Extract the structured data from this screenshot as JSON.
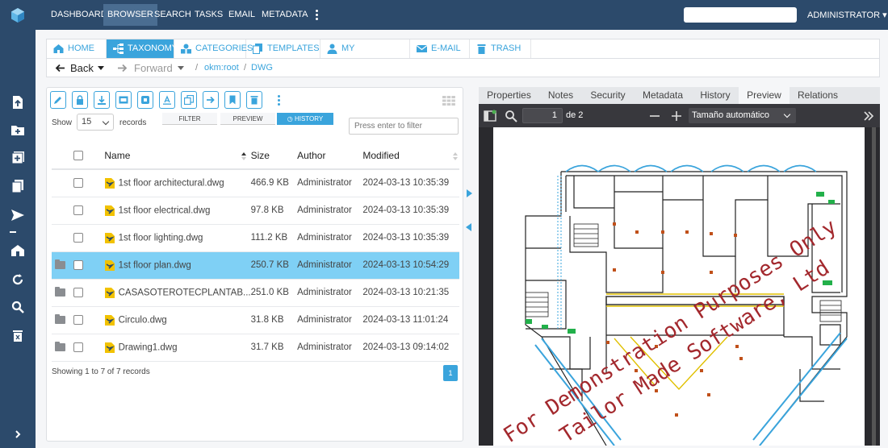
{
  "topnav": {
    "items": [
      "DASHBOARD",
      "BROWSER",
      "SEARCH",
      "TASKS",
      "EMAIL",
      "METADATA"
    ],
    "active": "BROWSER",
    "user": "ADMINISTRATOR ▾"
  },
  "tabs": [
    {
      "label": "HOME",
      "icon": "home-icon"
    },
    {
      "label": "TAXONOMY",
      "icon": "sitemap-icon"
    },
    {
      "label": "CATEGORIES",
      "icon": "shapes-icon"
    },
    {
      "label": "TEMPLATES",
      "icon": "copy-icon"
    },
    {
      "label": "MY DOCUMENTS",
      "icon": "user-icon"
    },
    {
      "label": "E-MAIL",
      "icon": "envelope-icon"
    },
    {
      "label": "TRASH",
      "icon": "trash-icon"
    }
  ],
  "navbar": {
    "back": "Back",
    "forward": "Forward",
    "path": [
      "okm:root",
      "DWG"
    ]
  },
  "browser": {
    "subtabs": [
      "FILTER",
      "PREVIEW",
      "HISTORY"
    ],
    "active_subtab": "HISTORY",
    "show_label": "Show",
    "page_size": "15",
    "records_label": "records",
    "filter_placeholder": "Press enter to filter",
    "columns": [
      "Name",
      "Size",
      "Author",
      "Modified"
    ],
    "rows": [
      {
        "name": "1st floor architectural.dwg",
        "size": "466.9 KB",
        "author": "Administrator",
        "modified": "2024-03-13 10:35:39",
        "selected": false,
        "locked": false
      },
      {
        "name": "1st floor electrical.dwg",
        "size": "97.8 KB",
        "author": "Administrator",
        "modified": "2024-03-13 10:35:39",
        "selected": false,
        "locked": false
      },
      {
        "name": "1st floor lighting.dwg",
        "size": "111.2 KB",
        "author": "Administrator",
        "modified": "2024-03-13 10:35:39",
        "selected": false,
        "locked": false
      },
      {
        "name": "1st floor plan.dwg",
        "size": "250.7 KB",
        "author": "Administrator",
        "modified": "2024-03-13 10:54:29",
        "selected": true,
        "locked": true
      },
      {
        "name": "CASASOTEROTECPLANTAB...",
        "size": "251.0 KB",
        "author": "Administrator",
        "modified": "2024-03-13 10:21:35",
        "selected": false,
        "locked": true
      },
      {
        "name": "Circulo.dwg",
        "size": "31.8 KB",
        "author": "Administrator",
        "modified": "2024-03-13 11:01:24",
        "selected": false,
        "locked": true
      },
      {
        "name": "Drawing1.dwg",
        "size": "31.7 KB",
        "author": "Administrator",
        "modified": "2024-03-13 09:14:02",
        "selected": false,
        "locked": true
      }
    ],
    "summary": "Showing 1 to 7 of 7 records",
    "current_page": "1"
  },
  "viewer": {
    "tabs": [
      "Properties",
      "Notes",
      "Security",
      "Metadata",
      "History",
      "Preview",
      "Relations"
    ],
    "active_tab": "Preview",
    "page_number": "1",
    "page_total": "de 2",
    "zoom": "Tamaño automático",
    "watermark_line1": "For Demonstration Purposes Only",
    "watermark_line2": "Tailor Made Software, Ltd"
  },
  "colors": {
    "navy": "#2c4a6b",
    "accent": "#3aa4dc",
    "selected_row": "#7fd0f5",
    "watermark": "#a3282d"
  }
}
